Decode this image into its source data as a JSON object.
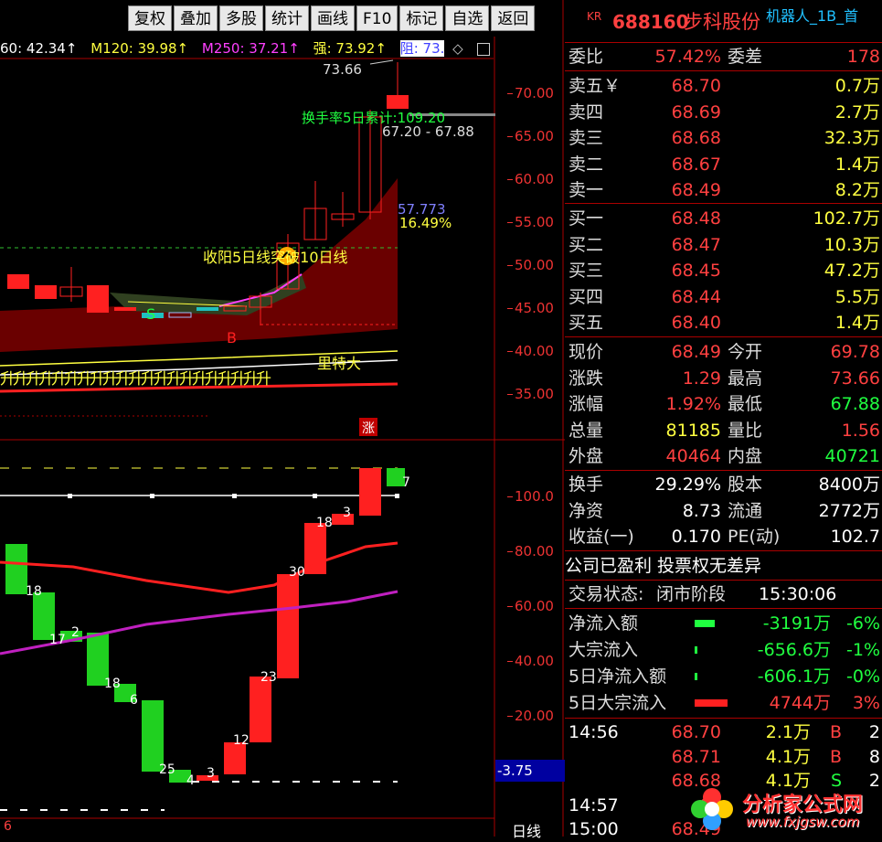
{
  "toolbar": [
    "复权",
    "叠加",
    "多股",
    "统计",
    "画线",
    "F10",
    "标记",
    "自选",
    "返回"
  ],
  "legend": {
    "m60": "60: 42.34↑",
    "m120": "M120: 39.98↑",
    "m250": "M250: 37.21↑",
    "strong": "强: 73.92↑",
    "resist": "阻: 73.",
    "diamond": "◇"
  },
  "price_axis": [
    "70.00",
    "65.00",
    "60.00",
    "55.00",
    "50.00",
    "45.00",
    "40.00",
    "35.00"
  ],
  "ind_axis": [
    "100.0",
    "80.00",
    "60.00",
    "40.00",
    "20.00"
  ],
  "ind_value": "-3.75",
  "period_label": "日线",
  "bottom_left_num": "6",
  "annotations": {
    "high": "73.66",
    "turnover": "换手率5日累计:109.20",
    "range": "67.20 - 67.88",
    "ma_val": "57.773",
    "pct": "16.49%",
    "signal": "收阳5日线突破10日线",
    "b_mark": "B",
    "s_mark": "S",
    "litedai": "里特大",
    "zhang": "涨",
    "row_text": "升升升升升升升升升升升升升升升升升升升升升"
  },
  "header": {
    "code_prefix": "KR",
    "code": "688160",
    "name": "步科股份",
    "tag": "机器人_1B_首"
  },
  "weibi": {
    "label1": "委比",
    "val1": "57.42%",
    "label2": "委差",
    "val2": "178"
  },
  "sell": [
    {
      "label": "卖五￥",
      "price": "68.70",
      "vol": "0.7万"
    },
    {
      "label": "卖四",
      "price": "68.69",
      "vol": "2.7万"
    },
    {
      "label": "卖三",
      "price": "68.68",
      "vol": "32.3万"
    },
    {
      "label": "卖二",
      "price": "68.67",
      "vol": "1.4万"
    },
    {
      "label": "卖一",
      "price": "68.49",
      "vol": "8.2万"
    }
  ],
  "buy": [
    {
      "label": "买一",
      "price": "68.48",
      "vol": "102.7万"
    },
    {
      "label": "买二",
      "price": "68.47",
      "vol": "10.3万"
    },
    {
      "label": "买三",
      "price": "68.45",
      "vol": "47.2万"
    },
    {
      "label": "买四",
      "price": "68.44",
      "vol": "5.5万"
    },
    {
      "label": "买五",
      "price": "68.40",
      "vol": "1.4万"
    }
  ],
  "quote": [
    {
      "l1": "现价",
      "v1": "68.49",
      "l2": "今开",
      "v2": "69.78"
    },
    {
      "l1": "涨跌",
      "v1": "1.29",
      "l2": "最高",
      "v2": "73.66"
    },
    {
      "l1": "涨幅",
      "v1": "1.92%",
      "l2": "最低",
      "v2": "67.88"
    },
    {
      "l1": "总量",
      "v1": "81185",
      "l2": "量比",
      "v2": "1.56"
    },
    {
      "l1": "外盘",
      "v1": "40464",
      "l2": "内盘",
      "v2": "40721"
    }
  ],
  "fund": [
    {
      "l1": "换手",
      "v1": "29.29%",
      "l2": "股本",
      "v2": "8400万"
    },
    {
      "l1": "净资",
      "v1": "8.73",
      "l2": "流通",
      "v2": "2772万"
    },
    {
      "l1": "收益(一)",
      "v1": "0.170",
      "l2": "PE(动)",
      "v2": "102.7"
    }
  ],
  "profit_text": "公司已盈利  投票权无差异",
  "trade_status": {
    "label": "交易状态:",
    "value": "闭市阶段",
    "time": "15:30:06"
  },
  "flows": [
    {
      "label": "净流入额",
      "value": "-3191万",
      "pct": "-6%",
      "bar": "green",
      "w": 22
    },
    {
      "label": "大宗流入",
      "value": "-656.6万",
      "pct": "-1%",
      "bar": "green",
      "w": 3
    },
    {
      "label": "5日净流入额",
      "value": "-606.1万",
      "pct": "-0%",
      "bar": "green",
      "w": 3
    },
    {
      "label": "5日大宗流入",
      "value": "4744万",
      "pct": "3%",
      "bar": "red",
      "w": 36
    }
  ],
  "ticks": [
    {
      "time": "14:56",
      "price": "68.70",
      "vol": "2.1万",
      "side": "B",
      "n": "2"
    },
    {
      "time": "",
      "price": "68.71",
      "vol": "4.1万",
      "side": "B",
      "n": "8"
    },
    {
      "time": "",
      "price": "68.68",
      "vol": "4.1万",
      "side": "S",
      "n": "2"
    },
    {
      "time": "14:57",
      "price": "68",
      "vol": "",
      "side": "",
      "n": ""
    },
    {
      "time": "15:00",
      "price": "68.49",
      "vol": "",
      "side": "",
      "n": ""
    }
  ],
  "watermark": {
    "cn": "分析家公式网",
    "url": "www.fxjgsw.com"
  },
  "colors": {
    "up": "#ff2020",
    "down": "#20ff40",
    "axis": "#aa0000",
    "accent": "#ffff40"
  }
}
